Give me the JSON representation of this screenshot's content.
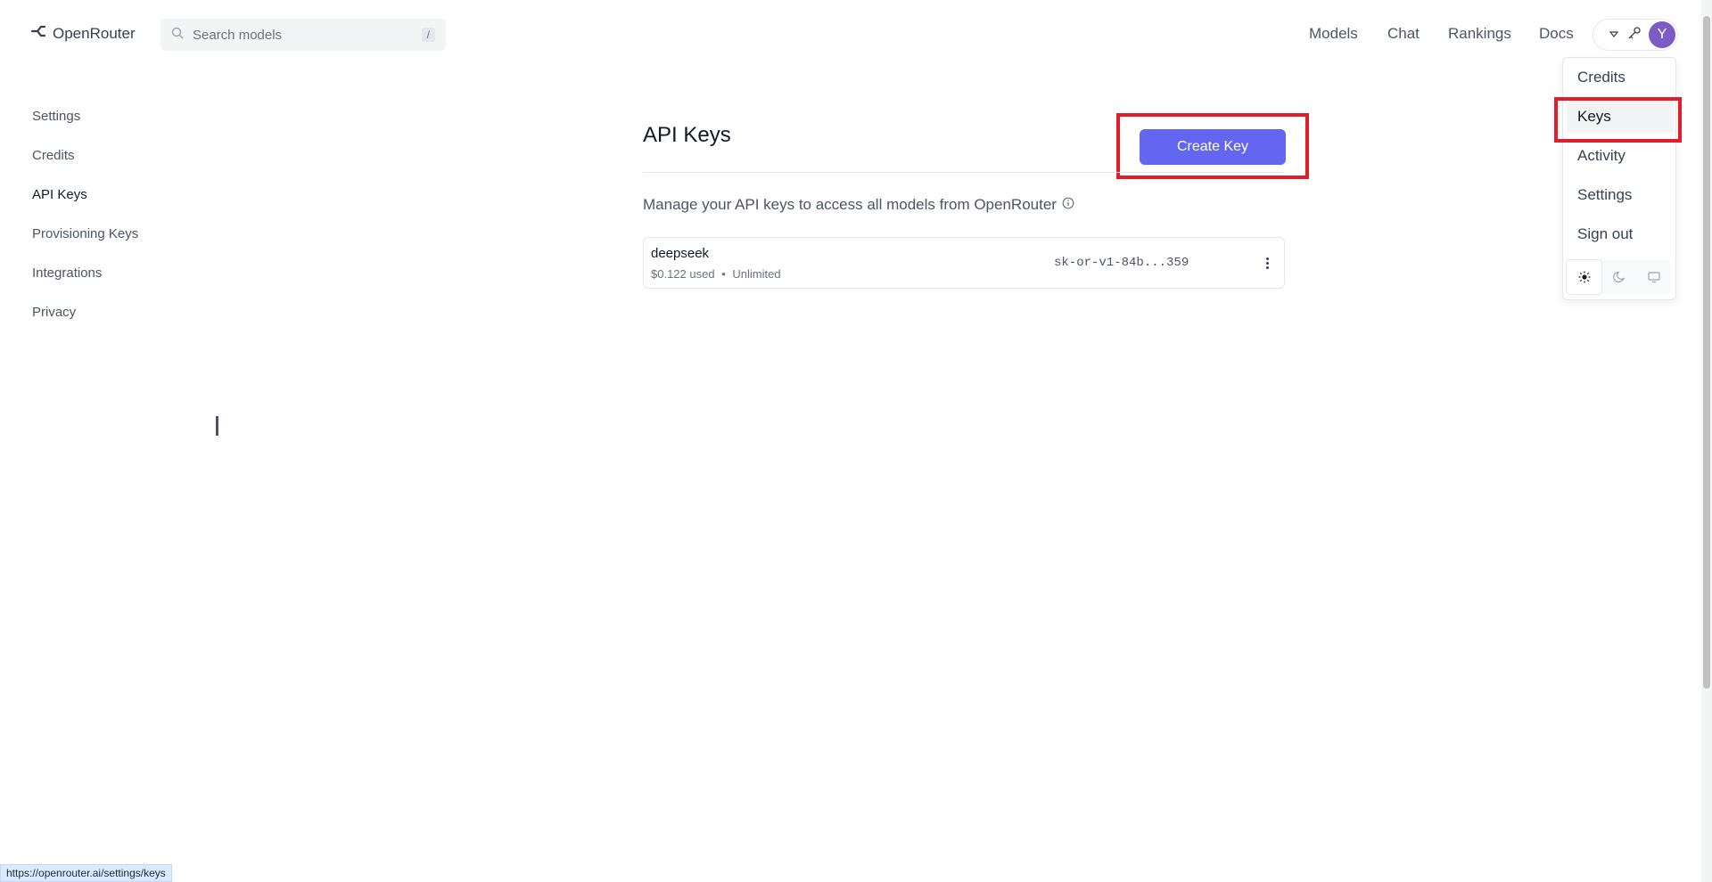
{
  "brand": {
    "name": "OpenRouter"
  },
  "search": {
    "placeholder": "Search models",
    "shortcut": "/"
  },
  "nav": {
    "models": "Models",
    "chat": "Chat",
    "rankings": "Rankings",
    "docs": "Docs"
  },
  "account": {
    "avatar_letter": "Y"
  },
  "sidebar": {
    "items": [
      {
        "label": "Settings"
      },
      {
        "label": "Credits"
      },
      {
        "label": "API Keys"
      },
      {
        "label": "Provisioning Keys"
      },
      {
        "label": "Integrations"
      },
      {
        "label": "Privacy"
      }
    ],
    "active": "API Keys"
  },
  "main": {
    "title": "API Keys",
    "create_button": "Create Key",
    "description": "Manage your API keys to access all models from OpenRouter",
    "keys": [
      {
        "name": "deepseek",
        "used": "$0.122 used",
        "limit": "Unlimited",
        "key_masked": "sk-or-v1-84b...359"
      }
    ]
  },
  "dropdown": {
    "items": [
      {
        "label": "Credits"
      },
      {
        "label": "Keys"
      },
      {
        "label": "Activity"
      },
      {
        "label": "Settings"
      },
      {
        "label": "Sign out"
      }
    ],
    "active": "Keys",
    "theme_options": [
      "sun-icon",
      "moon-icon",
      "monitor-icon"
    ]
  },
  "status_bar": {
    "url": "https://openrouter.ai/settings/keys"
  },
  "colors": {
    "accent": "#6366f1",
    "highlight": "#e11d2a",
    "avatar": "#7c5cc4"
  }
}
